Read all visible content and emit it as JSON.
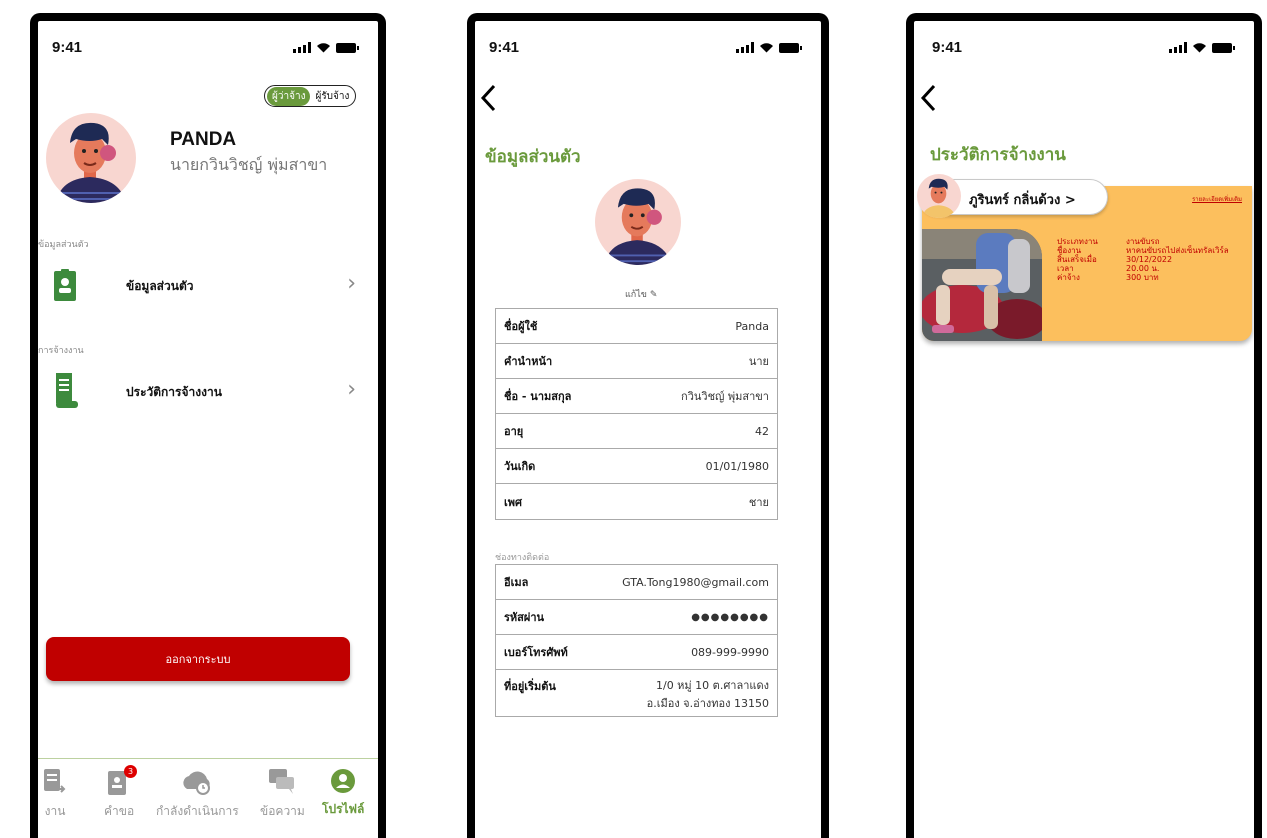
{
  "status": {
    "time": "9:41"
  },
  "screen1": {
    "role_toggle": {
      "active": "ผู้ว่าจ้าง",
      "inactive": "ผู้รับจ้าง"
    },
    "profile": {
      "nickname": "PANDA",
      "fullname": "นายกวินวิชญ์  พุ่มสาขา"
    },
    "section_personal": "ข้อมูลส่วนตัว",
    "menu_personal": "ข้อมูลส่วนตัว",
    "section_hiring": "การจ้างงาน",
    "menu_history": "ประวัติการจ้างงาน",
    "logout": "ออกจากระบบ",
    "tabs": [
      {
        "label": "งาน",
        "icon": "document-arrow-icon"
      },
      {
        "label": "คำขอ",
        "icon": "request-icon",
        "badge": "3"
      },
      {
        "label": "กำลังดำเนินการ",
        "icon": "cloud-clock-icon"
      },
      {
        "label": "ข้อความ",
        "icon": "chat-icon"
      },
      {
        "label": "โปรไฟล์",
        "icon": "profile-icon"
      }
    ]
  },
  "screen2": {
    "title": "ข้อมูลส่วนตัว",
    "edit": "แก้ไข",
    "personal_rows": [
      {
        "key": "ชื่อผู้ใช้",
        "value": "Panda"
      },
      {
        "key": "คำนำหน้า",
        "value": "นาย"
      },
      {
        "key": "ชื่อ - นามสกุล",
        "value": "กวินวิชญ์ พุ่มสาขา"
      },
      {
        "key": "อายุ",
        "value": "42"
      },
      {
        "key": "วันเกิด",
        "value": "01/01/1980"
      },
      {
        "key": "เพศ",
        "value": "ชาย"
      }
    ],
    "contact_label": "ช่องทางติดต่อ",
    "contact_rows": [
      {
        "key": "อีเมล",
        "value": "GTA.Tong1980@gmail.com"
      },
      {
        "key": "รหัสผ่าน",
        "value": "●●●●●●●●"
      },
      {
        "key": "เบอร์โทรศัพท์",
        "value": "089-999-9990"
      },
      {
        "key": "ที่อยู่เริ่มต้น",
        "value_line1": "1/0 หมู่ 10 ต.ศาลาแดง",
        "value_line2": "อ.เมือง จ.อ่างทอง 13150"
      }
    ]
  },
  "screen3": {
    "title": "ประวัติการจ้างงาน",
    "card": {
      "person": "ภูรินทร์  กลิ่นด้วง >",
      "detail_link": "รายละเอียดเพิ่มเติม",
      "labels": [
        "ประเภทงาน",
        "ชื่องาน",
        "สิ้นเสร็จเมื่อ",
        "เวลา",
        "ค่าจ้าง"
      ],
      "values": [
        "งานขับรถ",
        "หาคนขับรถไปส่งเซ็นทรัลเวิร์ล",
        "30/12/2022",
        "20.00 น.",
        "300 บาท"
      ]
    }
  }
}
